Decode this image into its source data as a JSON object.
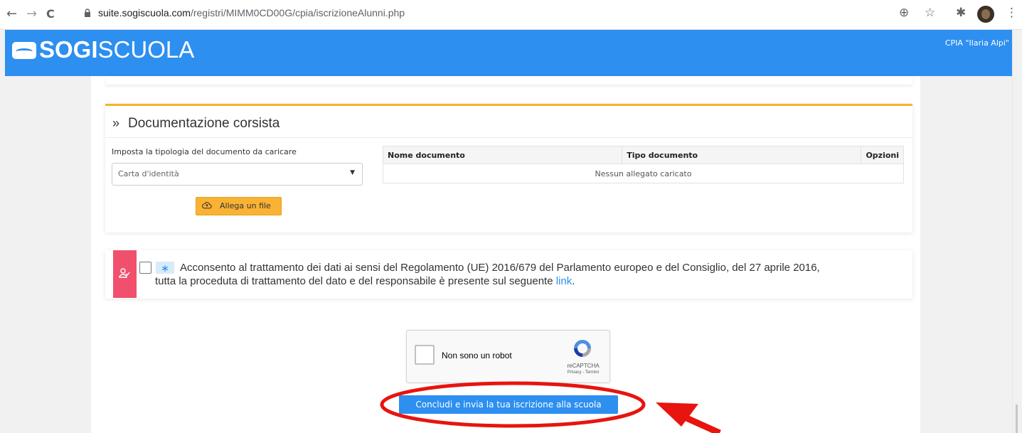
{
  "browser": {
    "url_host": "suite.sogiscuola.com",
    "url_path": "/registri/MIMM0CD00G/cpia/iscrizioneAlunni.php",
    "back_icon": "←",
    "forward_icon": "→",
    "reload_icon": "C",
    "zoom_icon": "⊕",
    "star_icon": "☆",
    "extensions_icon": "✱",
    "menu_icon": "⋮"
  },
  "header": {
    "logo_bold": "SOGI",
    "logo_light": "SCUOLA",
    "school_name": "CPIA \"Ilaria Alpi\"",
    "color": "#2d8ff0"
  },
  "documents": {
    "chevron": "»",
    "title": "Documentazione corsista",
    "type_label": "Imposta la tipologia del documento da caricare",
    "type_selected": "Carta d'identità",
    "attach_label": "Allega un file",
    "accent": "#f9b234",
    "table": {
      "col_name": "Nome documento",
      "col_type": "Tipo documento",
      "col_options": "Opzioni",
      "empty": "Nessun allegato caricato"
    }
  },
  "consent": {
    "asterisk": "∗",
    "text_line1": "Acconsento al trattamento dei dati ai sensi del Regolamento (UE) 2016/679 del Parlamento europeo e del Consiglio, del 27 aprile 2016,",
    "text_line2": "tutta la proceduta di trattamento del dato e del responsabile è presente sul seguente ",
    "link": "link",
    "after_link": ".",
    "accent": "#f0506e"
  },
  "captcha": {
    "label": "Non sono un robot",
    "brand": "reCAPTCHA",
    "links": "Privacy - Termini"
  },
  "submit": {
    "label": "Concludi e invia la tua iscrizione alla scuola"
  }
}
